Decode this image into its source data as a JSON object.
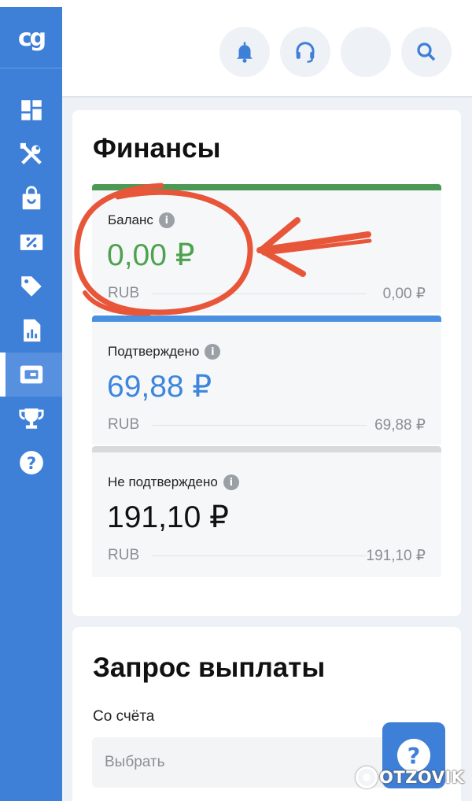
{
  "app": {
    "logo_text": "cg"
  },
  "sidebar": {
    "items": [
      {
        "icon": "dashboard-icon",
        "active": false
      },
      {
        "icon": "tools-icon",
        "active": false
      },
      {
        "icon": "shopping-bag-icon",
        "active": false
      },
      {
        "icon": "coupon-icon",
        "active": false
      },
      {
        "icon": "tag-icon",
        "active": false
      },
      {
        "icon": "report-icon",
        "active": false
      },
      {
        "icon": "wallet-icon",
        "active": true
      },
      {
        "icon": "trophy-icon",
        "active": false
      },
      {
        "icon": "help-icon",
        "active": false
      }
    ]
  },
  "header": {
    "buttons": [
      "bell-icon",
      "headset-icon",
      "avatar",
      "search-icon"
    ]
  },
  "finance": {
    "title": "Финансы",
    "balance": {
      "label": "Баланс",
      "amount": "0,00 ₽",
      "currency": "RUB",
      "sum": "0,00 ₽",
      "accent": "#4a9a55"
    },
    "confirmed": {
      "label": "Подтверждено",
      "amount": "69,88 ₽",
      "currency": "RUB",
      "sum": "69,88 ₽",
      "accent": "#4a8fe0"
    },
    "unconfirmed": {
      "label": "Не подтверждено",
      "amount": "191,10 ₽",
      "currency": "RUB",
      "sum": "191,10 ₽",
      "accent": "#d9d9d9"
    },
    "info_glyph": "i"
  },
  "payout": {
    "title": "Запрос выплаты",
    "from_label": "Со счёта",
    "select_placeholder": "Выбрать"
  },
  "watermark": "OTZOVIK",
  "colors": {
    "sidebar": "#3e7fd8",
    "annotation": "#e8563a"
  }
}
